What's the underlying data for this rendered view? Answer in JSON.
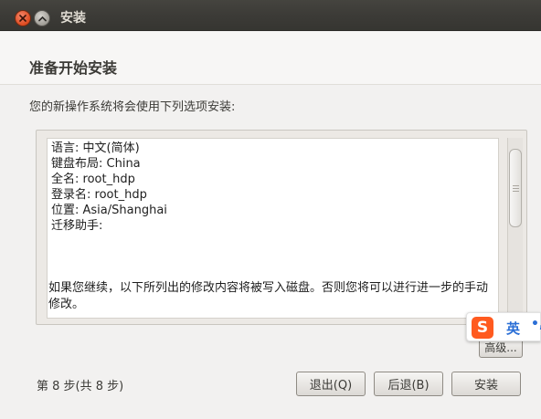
{
  "window": {
    "title": "安装"
  },
  "page": {
    "heading": "准备开始安装",
    "intro": "您的新操作系统将会使用下列选项安装:"
  },
  "summary": {
    "lines": [
      "语言: 中文(简体)",
      "键盘布局: China",
      "全名: root_hdp",
      "登录名: root_hdp",
      "位置: Asia/Shanghai",
      "迁移助手:"
    ],
    "warning": "如果您继续，以下所列出的修改内容将被写入磁盘。否则您将可以进行进一步的手动修改。"
  },
  "buttons": {
    "advanced": "高级...",
    "quit": "退出(Q)",
    "back": "后退(B)",
    "install": "安装"
  },
  "footer": {
    "step": "第 8 步(共 8 步)"
  },
  "ime": {
    "logo": "S",
    "lang": "英",
    "extra": "•,"
  },
  "colors": {
    "titlebar": "#3c3b37",
    "close": "#de4a1f",
    "ime_accent": "#ff5a1f"
  }
}
